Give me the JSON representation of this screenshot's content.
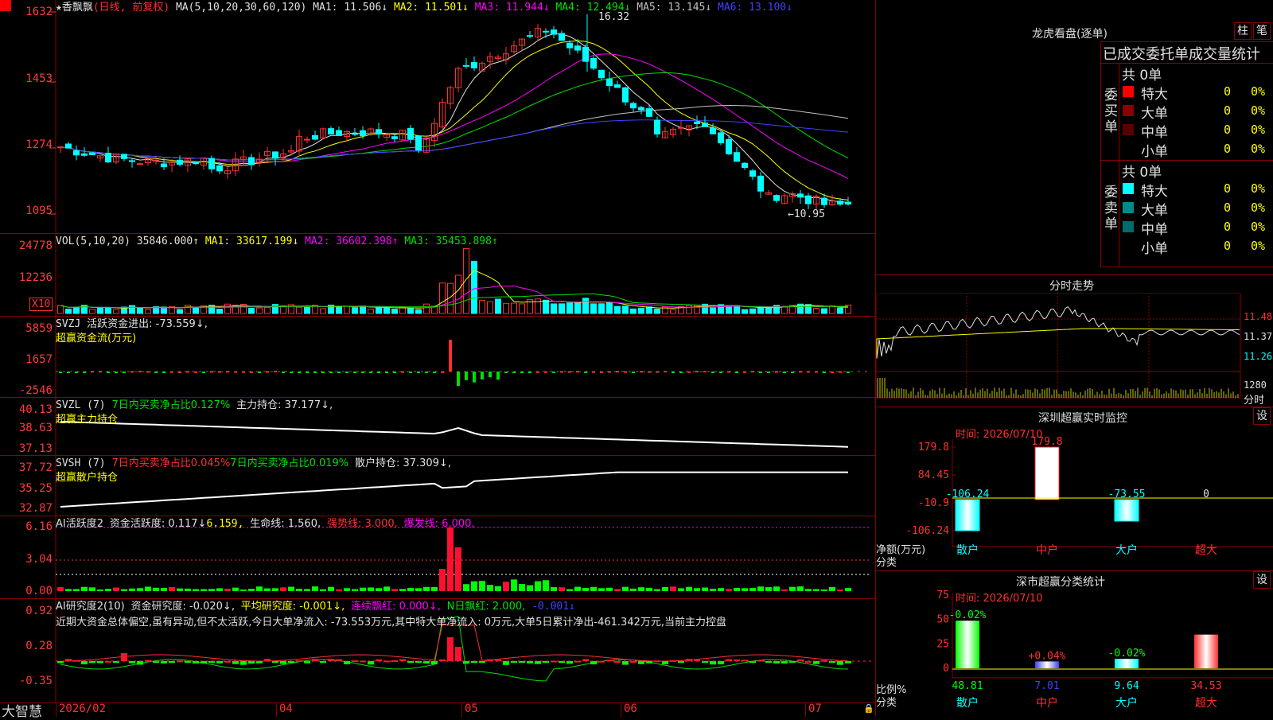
{
  "main": {
    "stock_name": "香飘飘",
    "period": "(日线, 前复权)",
    "ma_params": "MA(5,10,20,30,60,120)",
    "ma": [
      {
        "label": "MA1:",
        "value": "11.506↓",
        "color": "#e0e0e0"
      },
      {
        "label": "MA2:",
        "value": "11.501↓",
        "color": "#ffff00"
      },
      {
        "label": "MA3:",
        "value": "11.944↓",
        "color": "#ff00ff"
      },
      {
        "label": "MA4:",
        "value": "12.494↓",
        "color": "#00e000"
      },
      {
        "label": "MA5:",
        "value": "13.145↓",
        "color": "#c0c0c0"
      },
      {
        "label": "MA6:",
        "value": "13.100↓",
        "color": "#4040ff"
      }
    ],
    "y_labels": [
      "1632",
      "1453",
      "1274",
      "1095"
    ],
    "high_label": "16.32",
    "low_label": "←10.95"
  },
  "vol": {
    "title": "VOL(5,10,20)",
    "value": "35846.000↑",
    "ma": [
      {
        "label": "MA1:",
        "value": "33617.199↓",
        "color": "#ffff00"
      },
      {
        "label": "MA2:",
        "value": "36602.398↑",
        "color": "#ff00ff"
      },
      {
        "label": "MA3:",
        "value": "35453.898↑",
        "color": "#00e000"
      }
    ],
    "y_labels": [
      "24778",
      "12236"
    ],
    "unit": "X10"
  },
  "svzj": {
    "title": "SVZJ",
    "line1": "活跃资金进出: -73.559↓,",
    "line2": "超赢资金流(万元)",
    "y_labels": [
      "5859",
      "1657",
      "-2546"
    ]
  },
  "svzl": {
    "title": "SVZL (7)",
    "part1": "7日内买卖净占比0.127%",
    "part2": "主力持仓: 37.177↓,",
    "line2": "超赢主力持仓",
    "y_labels": [
      "40.13",
      "38.63",
      "37.13"
    ]
  },
  "svsh": {
    "title": "SVSH (7)",
    "part1": "7日内买卖净占比0.045%",
    "part2": "7日内买卖净占比0.019%",
    "part3": "散户持仓: 37.309↓,",
    "line2": "超赢散户持仓",
    "y_labels": [
      "37.72",
      "35.25",
      "32.87"
    ]
  },
  "ai1": {
    "title": "AI活跃度2",
    "part1": "资金活跃度: 0.117↓",
    "part2": "6.159,",
    "part3": "生命线: 1.560,",
    "part4": "强势线: 3.000,",
    "part5": "爆发线: 6.000,",
    "y_labels": [
      "6.16",
      "3.04",
      "0.00"
    ]
  },
  "ai2": {
    "title": "AI研究度2(10)",
    "part1": "资金研究度: -0.020↓,",
    "part2": "平均研究度: -0.001↓,",
    "part3": "连续飘红: 0.000↓,",
    "part4": "N日飘红: 2.000,",
    "part5": "-0.001↓",
    "comment": "近期大资金总体偏空,虽有异动,但不太活跃,今日大单净流入: -73.553万元,其中特大单净流入: 0万元,大单5日累计净出-461.342万元,当前主力控盘",
    "y_labels": [
      "0.92",
      "0.28",
      "-0.35"
    ]
  },
  "xaxis": {
    "brand": "大智慧",
    "labels": [
      "2026/02",
      "04",
      "05",
      "06",
      "07"
    ]
  },
  "lhb": {
    "title": "龙虎看盘(逐单)",
    "btn1": "柱",
    "btn2": "笔",
    "subtitle": "已成交委托单成交量统计",
    "buy": {
      "side": "委买单",
      "total": "共 0单",
      "rows": [
        {
          "label": "特大",
          "value": "0",
          "pct": "0%",
          "color": "#ff0000"
        },
        {
          "label": "大单",
          "value": "0",
          "pct": "0%",
          "color": "#8b0000"
        },
        {
          "label": "中单",
          "value": "0",
          "pct": "0%",
          "color": "#5a0000"
        },
        {
          "label": "小单",
          "value": "0",
          "pct": "0%",
          "color": "#000000"
        }
      ]
    },
    "sell": {
      "side": "委卖单",
      "total": "共 0单",
      "rows": [
        {
          "label": "特大",
          "value": "0",
          "pct": "0%",
          "color": "#00ffff"
        },
        {
          "label": "大单",
          "value": "0",
          "pct": "0%",
          "color": "#008b8b"
        },
        {
          "label": "中单",
          "value": "0",
          "pct": "0%",
          "color": "#006b6b"
        },
        {
          "label": "小单",
          "value": "0",
          "pct": "0%",
          "color": "#000000"
        }
      ]
    }
  },
  "intraday": {
    "title": "分时走势",
    "y_labels": [
      "11.48",
      "11.37",
      "11.26"
    ],
    "vol_label": "1280",
    "vol_unit": "分时"
  },
  "monitor": {
    "title": "深圳超赢实时监控",
    "btn": "设",
    "time": "时间: 2026/07/10",
    "y_labels": [
      "179.8",
      "84.45",
      "-10.9",
      "-106.24"
    ],
    "axis_title1": "净额(万元)",
    "axis_title2": "分类",
    "categories": [
      "散户",
      "中户",
      "大户",
      "超大"
    ],
    "values": [
      -106.24,
      179.8,
      -73.55,
      0
    ],
    "value_labels": [
      "-106.24",
      "179.8",
      "-73.55",
      "0"
    ]
  },
  "classify": {
    "title": "深市超赢分类统计",
    "btn": "设",
    "time": "时间: 2026/07/10",
    "y_labels": [
      "75",
      "50",
      "25",
      "0"
    ],
    "axis_title1": "比例%",
    "axis_title2": "分类",
    "categories": [
      "散户",
      "中户",
      "大户",
      "超大"
    ],
    "values": [
      48.81,
      7.01,
      9.64,
      34.53
    ],
    "value_labels": [
      "48.81",
      "7.01",
      "9.64",
      "34.53"
    ],
    "change_labels": [
      "-0.02%",
      "+0.04%",
      "-0.02%",
      ""
    ]
  }
}
